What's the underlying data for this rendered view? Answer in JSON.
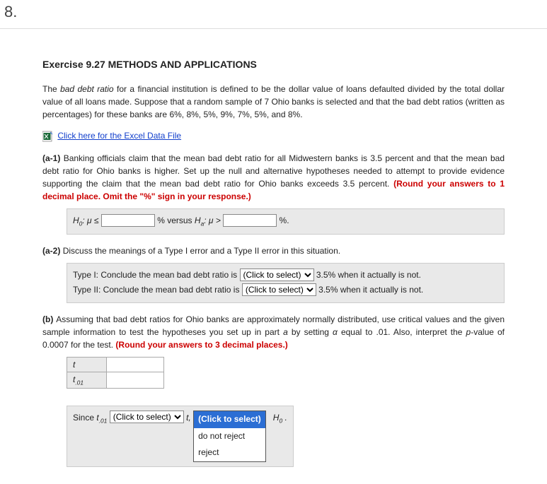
{
  "question_number": "8.",
  "exercise_title": "Exercise 9.27 METHODS AND APPLICATIONS",
  "intro": {
    "pre_italic": "The ",
    "italic": "bad debt ratio",
    "rest": " for a financial institution is defined to be the dollar value of loans defaulted divided by the total dollar value of all loans made. Suppose that a random sample of 7 Ohio banks is selected and that the bad debt ratios (written as percentages) for these banks are 6%, 8%, 5%, 9%, 7%, 5%, and 8%."
  },
  "excel_link": "Click here for the Excel Data File",
  "a1": {
    "label": "(a-1)",
    "text": "Banking officials claim that the mean bad debt ratio for all Midwestern banks is 3.5 percent and that the mean bad debt ratio for Ohio banks is higher. Set up the null and alternative hypotheses needed to attempt to provide evidence supporting the claim that the mean bad debt ratio for Ohio banks exceeds 3.5 percent. ",
    "warn": "(Round your answers to 1 decimal place. Omit the \"%\" sign in your response.)"
  },
  "hyp_box": {
    "h0_mu_lte": "H",
    "mu_le": "μ ≤",
    "pct_versus": "% versus",
    "ha": "H",
    "mu_gt": "μ >",
    "pct_end": "%."
  },
  "a2": {
    "label": "(a-2)",
    "text": "Discuss the meanings of a Type I error and a Type II error in this situation."
  },
  "types_box": {
    "type1_pre": "Type I:   Conclude the mean bad debt ratio is",
    "type1_post": "3.5% when it actually is not.",
    "type2_pre": "Type II:  Conclude the mean bad debt ratio is",
    "type2_post": "3.5% when it actually is not.",
    "click_to_select": "(Click to select)"
  },
  "b": {
    "label": "(b)",
    "text1": "Assuming that bad debt ratios for Ohio banks are approximately normally distributed, use critical values and the given sample information to test the hypotheses you set up in part ",
    "text_a": "a",
    "text2": " by setting ",
    "alpha": "α",
    "text3": " equal to .01. Also, interpret the ",
    "pval": "p",
    "text4": "-value of 0.0007 for the test. ",
    "warn": "(Round your answers to 3 decimal places.)"
  },
  "table": {
    "row1": "t",
    "row2": "t",
    "row2_sub": ".01"
  },
  "since": {
    "since": "Since ",
    "t01": "t",
    "t01_sub": ".01",
    "t_comma": "t,",
    "sel_placeholder": "(Click to select)",
    "open_selected": "(Click to select)",
    "open_opt1": "do not reject",
    "open_opt2": "reject",
    "h0_end": "H",
    "zero": "0",
    "dot": " ."
  }
}
